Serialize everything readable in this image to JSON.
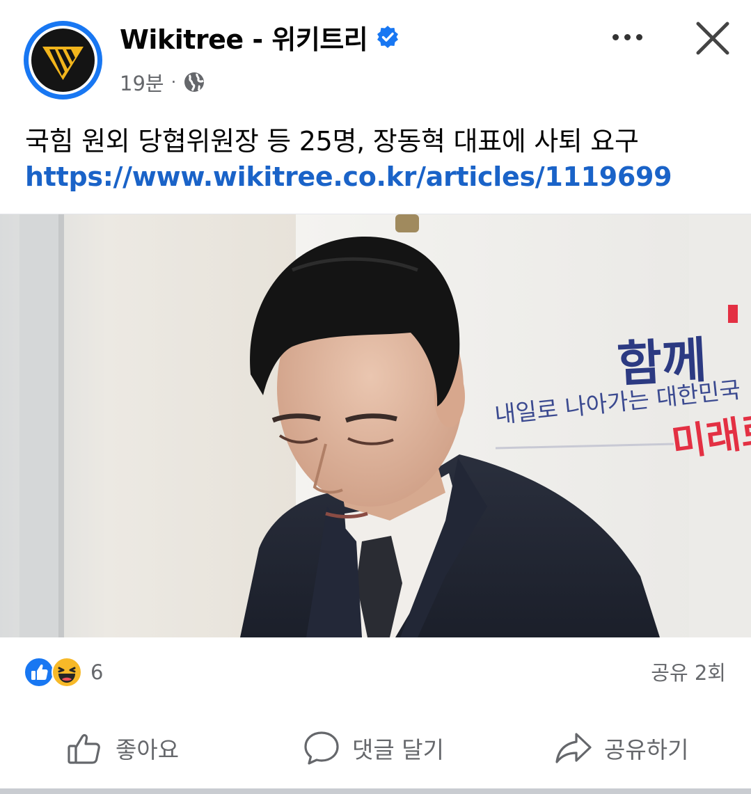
{
  "post": {
    "page_name": "Wikitree - 위키트리",
    "time": "19분",
    "separator": "·",
    "text": "국힘 원외 당협위원장 등 25명, 장동혁 대표에 사퇴 요구",
    "link": "https://www.wikitree.co.kr/articles/1119699",
    "verified": true,
    "privacy_icon": "globe-icon"
  },
  "photo": {
    "signage_line1": "함께",
    "signage_line2": "내일로 나아가는 대한민국",
    "signage_line3": "미래로"
  },
  "engagement": {
    "reaction_icons": [
      "like-reaction-icon",
      "haha-reaction-icon"
    ],
    "reaction_count": "6",
    "share_count": "공유 2회"
  },
  "actions": {
    "like": "좋아요",
    "comment": "댓글 달기",
    "share": "공유하기"
  },
  "colors": {
    "accent": "#1877f2",
    "link": "#1a63c8",
    "secondary_text": "#65676b",
    "logo_yellow": "#f2b51c"
  }
}
